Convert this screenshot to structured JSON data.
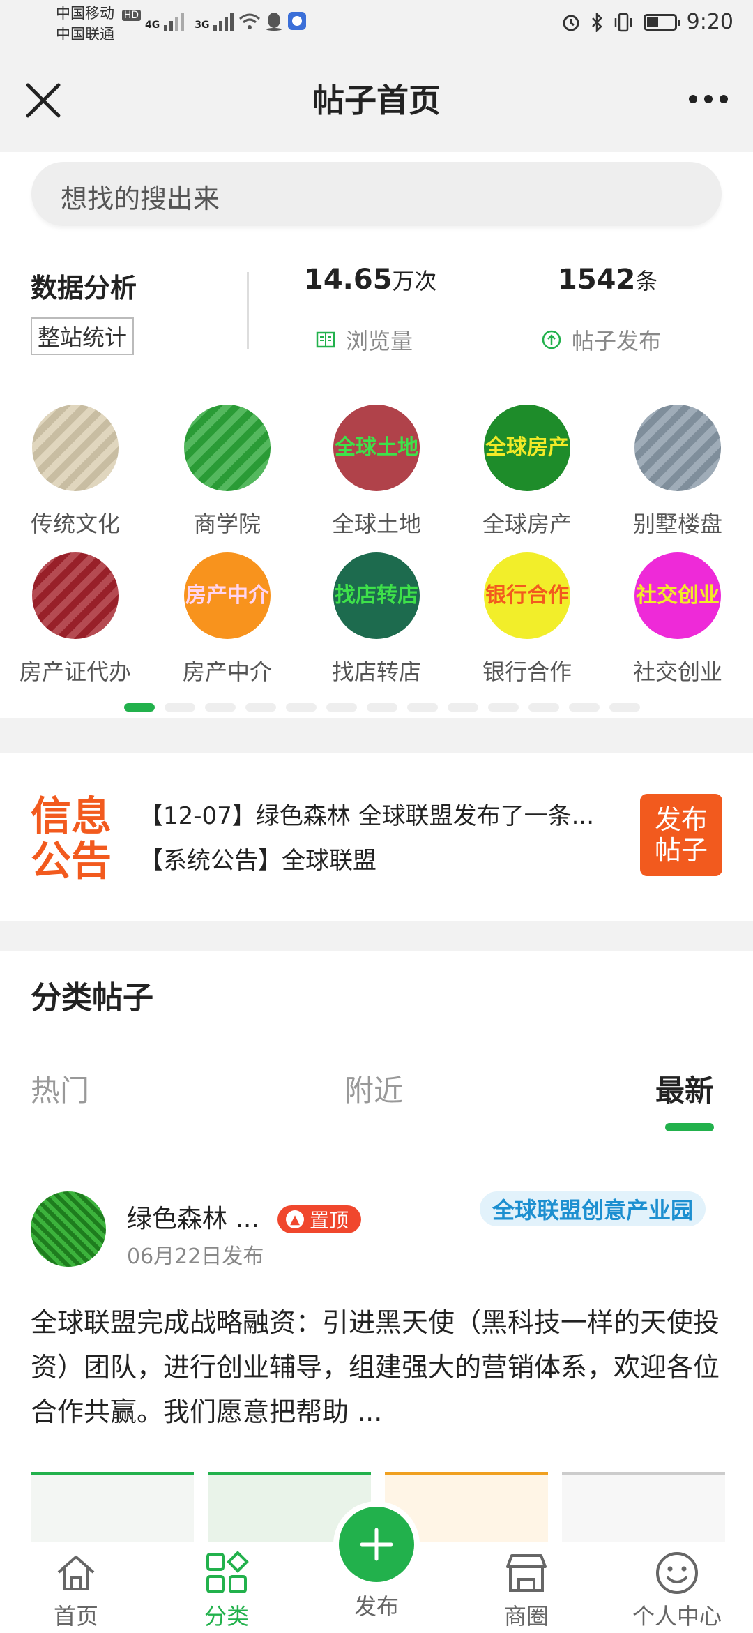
{
  "status_bar": {
    "carrier1": "中国移动",
    "carrier1_badge": "HD",
    "carrier2": "中国联通",
    "net1": "4G",
    "net2": "3G",
    "time": "9:20"
  },
  "header": {
    "title": "帖子首页"
  },
  "search": {
    "placeholder": "想找的搜出来"
  },
  "stats": {
    "title": "数据分析",
    "button": "整站统计",
    "views_value": "14.65",
    "views_unit": "万次",
    "views_label": "浏览量",
    "posts_value": "1542",
    "posts_unit": "条",
    "posts_label": "帖子发布"
  },
  "categories": [
    {
      "label": "传统文化",
      "circle_text": "",
      "color": "#d9cdb0"
    },
    {
      "label": "商学院",
      "circle_text": "",
      "color": "#2ea83a"
    },
    {
      "label": "全球土地",
      "circle_text": "全球\n土地",
      "color": "#b0424a",
      "text_color": "#3ee14a"
    },
    {
      "label": "全球房产",
      "circle_text": "全球\n房产",
      "color": "#1e8c2a",
      "text_color": "#f2ea28"
    },
    {
      "label": "别墅楼盘",
      "circle_text": "",
      "color": "#8a9aa8"
    },
    {
      "label": "房产证代办",
      "circle_text": "",
      "color": "#a5232c"
    },
    {
      "label": "房产中介",
      "circle_text": "房产\n中介",
      "color": "#f8931d",
      "text_color": "#ffd4f0"
    },
    {
      "label": "找店转店",
      "circle_text": "找店\n转店",
      "color": "#1d6b4e",
      "text_color": "#3ee14a"
    },
    {
      "label": "银行合作",
      "circle_text": "银行\n合作",
      "color": "#f2ee2a",
      "text_color": "#f25a1e"
    },
    {
      "label": "社交创业",
      "circle_text": "社交\n创业",
      "color": "#ee2ad8",
      "text_color": "#f2ea28"
    }
  ],
  "notice": {
    "logo_line1": "信息",
    "logo_line2": "公告",
    "line1": "【12-07】绿色森林 全球联盟发布了一条...",
    "line2": "【系统公告】全球联盟",
    "post_button_line1": "发布",
    "post_button_line2": "帖子"
  },
  "posts_section": {
    "title": "分类帖子",
    "tabs": [
      "热门",
      "附近",
      "最新"
    ],
    "active_tab": 2
  },
  "post": {
    "username": "绿色森林 ...",
    "pin_label": "置顶",
    "date": "06月22日发布",
    "tag": "全球联盟创意产业园",
    "content": "全球联盟完成战略融资：引进黑天使（黑科技一样的天使投资）团队，进行创业辅导，组建强大的营销体系，欢迎各位合作共赢。我们愿意把帮助 ..."
  },
  "bottom_nav": {
    "items": [
      "首页",
      "分类",
      "发布",
      "商圈",
      "个人中心"
    ],
    "active": 1
  },
  "colors": {
    "accent_green": "#22b14c",
    "orange": "#f25a1e",
    "pin_red": "#f0472d",
    "tag_blue": "#1d8fd0"
  }
}
